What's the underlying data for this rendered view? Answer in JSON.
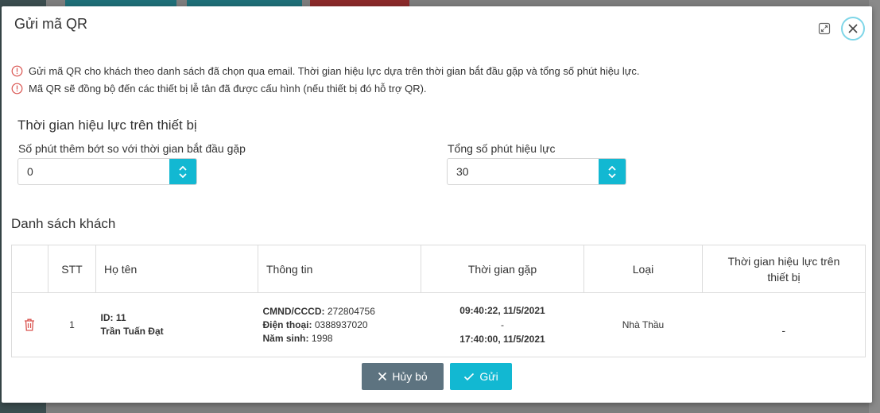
{
  "modal": {
    "title": "Gửi mã QR",
    "notes": [
      "Gửi mã QR cho khách theo danh sách đã chọn qua email. Thời gian hiệu lực dựa trên thời gian bắt đầu gặp và tổng số phút hiệu lực.",
      "Mã QR sẽ đồng bộ đến các thiết bị lễ tân đã được cấu hình (nếu thiết bị đó hỗ trợ QR)."
    ]
  },
  "validity": {
    "section_title": "Thời gian hiệu lực trên thiết bị",
    "offset_label": "Số phút thêm bớt so với thời gian bắt đầu gặp",
    "offset_value": "0",
    "total_label": "Tổng số phút hiệu lực",
    "total_value": "30"
  },
  "guests": {
    "title": "Danh sách khách",
    "columns": [
      "STT",
      "Họ tên",
      "Thông tin",
      "Thời gian gặp",
      "Loại",
      "Thời gian hiệu lực trên thiết bị"
    ],
    "rows": [
      {
        "stt": "1",
        "id_label": "ID: 11",
        "name": "Trần Tuấn Đạt",
        "cccd_label": "CMND/CCCD:",
        "cccd": "272804756",
        "phone_label": "Điện thoại:",
        "phone": "0388937020",
        "birth_label": "Năm sinh:",
        "birth": "1998",
        "time_start": "09:40:22, 11/5/2021",
        "time_sep": "-",
        "time_end": "17:40:00, 11/5/2021",
        "type": "Nhà Thầu",
        "validity": "-"
      }
    ]
  },
  "buttons": {
    "cancel": "Hủy bỏ",
    "send": "Gửi"
  },
  "colors": {
    "accent": "#12b8d2",
    "cancel": "#5d7380",
    "danger": "#d9534f"
  }
}
